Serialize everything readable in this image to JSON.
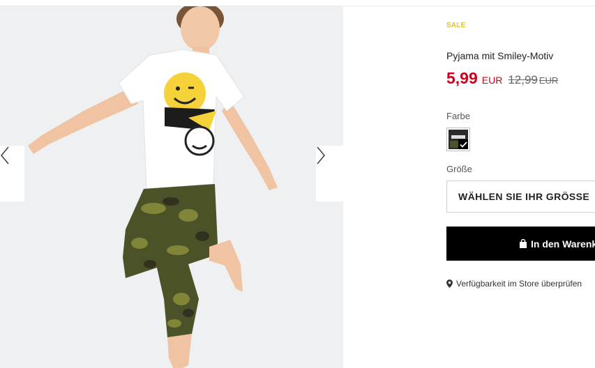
{
  "gallery": {
    "image_alt": "Pyjama mit Smiley-Motiv",
    "prev_icon": "chevron-left-icon",
    "next_icon": "chevron-right-icon"
  },
  "product": {
    "badge": "SALE",
    "title": "Pyjama mit Smiley-Motiv",
    "price_new": "5,99",
    "currency_new": "EUR",
    "price_old": "12,99",
    "currency_old": "EUR",
    "color_label": "Farbe",
    "size_label": "Größe",
    "size_select": "WÄHLEN SIE IHR GRÖSSE",
    "cart_button": "In den Warenkorb",
    "store_check": "Verfügbarkeit im Store überprüfen"
  },
  "colors": {
    "sale_badge": "#e8c02b",
    "price_new": "#d0011b",
    "button_bg": "#000000"
  }
}
